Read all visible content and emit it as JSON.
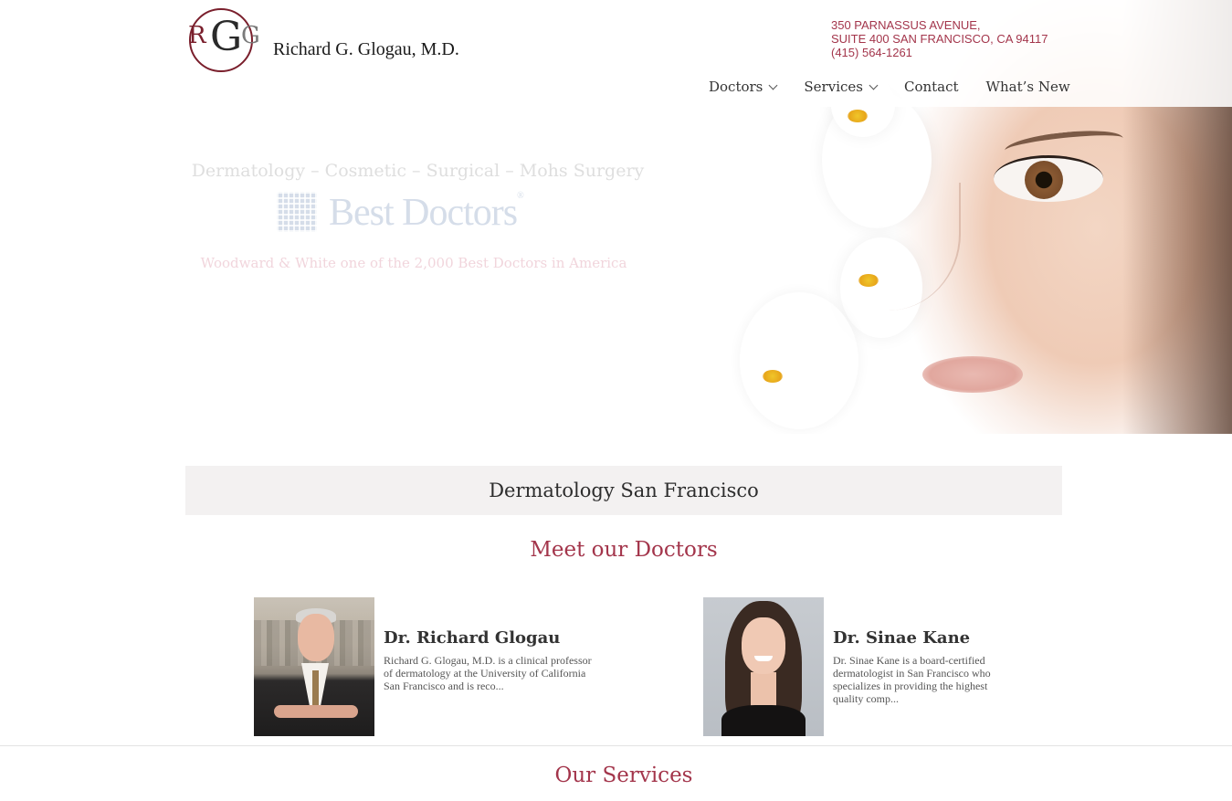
{
  "brand": {
    "logo_letters": [
      "R",
      "G",
      "G"
    ],
    "name": "Richard G. Glogau, M.D."
  },
  "address": {
    "line1": "350 PARNASSUS AVENUE,",
    "line2": "SUITE 400 SAN FRANCISCO, CA 94117",
    "phone": "(415) 564-1261"
  },
  "nav": {
    "items": [
      {
        "label": "Doctors",
        "has_dropdown": true
      },
      {
        "label": "Services",
        "has_dropdown": true
      },
      {
        "label": "Contact",
        "has_dropdown": false
      },
      {
        "label": "What’s New",
        "has_dropdown": false
      }
    ]
  },
  "hero": {
    "subtitle": "Dermatology – Cosmetic – Surgical – Mohs Surgery",
    "award_logo_text": "Best Doctors",
    "award_logo_mark": "®",
    "tagline": "Woodward & White one of the 2,000 Best Doctors in America"
  },
  "banner": {
    "title": "Dermatology San Francisco"
  },
  "doctors_section": {
    "heading": "Meet our Doctors",
    "doctors": [
      {
        "name": "Dr. Richard Glogau",
        "description": "Richard G. Glogau, M.D. is a clinical professor of dermatology at the University of California San Francisco and is reco..."
      },
      {
        "name": "Dr. Sinae Kane",
        "description": "Dr. Sinae Kane is a board-certified dermatologist in San Francisco who specializes in providing the highest quality comp..."
      }
    ]
  },
  "services_section": {
    "heading": "Our Services"
  },
  "colors": {
    "accent": "#a3354b",
    "logo_red": "#7a1f2c",
    "banner_bg": "#f3f1f1"
  }
}
